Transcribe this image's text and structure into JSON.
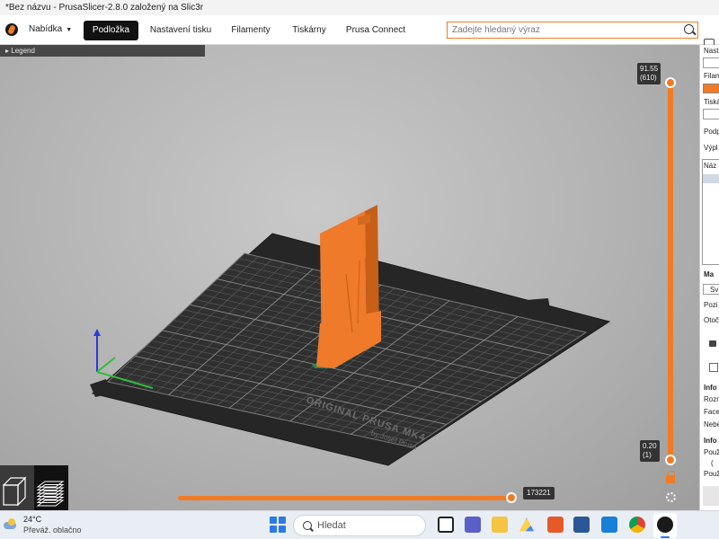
{
  "window": {
    "title": "*Bez názvu - PrusaSlicer-2.8.0 založený na Slic3r"
  },
  "toolbar": {
    "menu_label": "Nabídka",
    "tabs": [
      {
        "label": "Podložka",
        "active": true
      },
      {
        "label": "Nastavení tisku",
        "active": false
      },
      {
        "label": "Filamenty",
        "active": false
      },
      {
        "label": "Tiskárny",
        "active": false
      },
      {
        "label": "Prusa Connect",
        "active": false
      }
    ],
    "search_placeholder": "Zadejte hledaný výraz"
  },
  "viewport": {
    "legend_label": "Legend",
    "bed_text_line1": "ORIGINAL PRUSA MK4",
    "bed_text_line2": "by Josef Prusa",
    "vertical_slider": {
      "top_height": "91.55",
      "top_layer": "(610)",
      "bottom_height": "0.20",
      "bottom_layer": "(1)"
    },
    "horizontal_slider": {
      "value": "173221"
    }
  },
  "sidebar": {
    "labels": [
      "Nasta",
      "Filam",
      "Tiská",
      "Podp",
      "Výpl",
      "Náz",
      "Ma",
      "Sv",
      "Pozi",
      "Otoč",
      "Info",
      "Rozn",
      "Face",
      "Nebe",
      "Info",
      "Použ",
      "(",
      "Použ"
    ]
  },
  "colors": {
    "accent": "#f07b26",
    "active_tab_bg": "#111111"
  },
  "taskbar": {
    "temperature": "24°C",
    "condition": "Převáž. oblačno",
    "search_label": "Hledat",
    "apps": [
      "task-view",
      "teams",
      "file-explorer",
      "google-drive",
      "office",
      "word",
      "calendar",
      "chrome",
      "prusaslicer"
    ]
  }
}
